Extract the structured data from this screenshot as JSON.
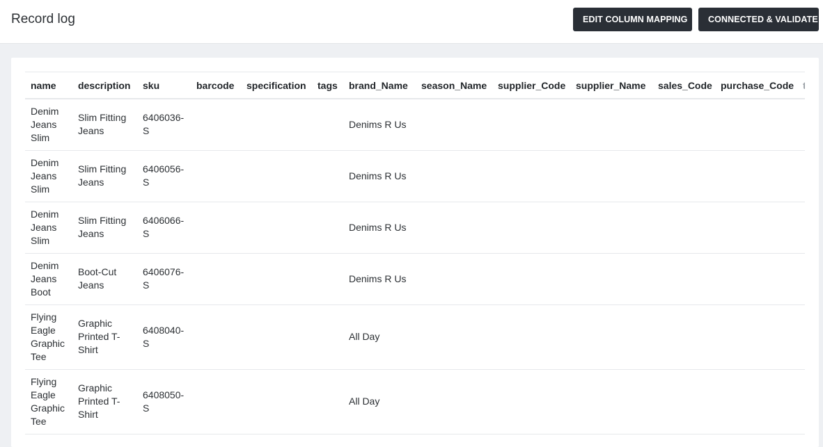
{
  "header": {
    "title": "Record log",
    "buttons": {
      "edit_mapping": "EDIT COLUMN MAPPING",
      "connect_validate": "CONNECTED & VALIDATE"
    }
  },
  "table": {
    "columns": [
      "name",
      "description",
      "sku",
      "barcode",
      "specification",
      "tags",
      "brand_Name",
      "season_Name",
      "supplier_Code",
      "supplier_Name",
      "sales_Code",
      "purchase_Code",
      "t"
    ],
    "rows": [
      {
        "name": "Denim Jeans Slim",
        "description": "Slim Fitting Jeans",
        "sku": "6406036-S",
        "brand_Name": "Denims R Us"
      },
      {
        "name": "Denim Jeans Slim",
        "description": "Slim Fitting Jeans",
        "sku": "6406056-S",
        "brand_Name": "Denims R Us"
      },
      {
        "name": "Denim Jeans Slim",
        "description": "Slim Fitting Jeans",
        "sku": "6406066-S",
        "brand_Name": "Denims R Us"
      },
      {
        "name": "Denim Jeans Boot",
        "description": "Boot-Cut Jeans",
        "sku": "6406076-S",
        "brand_Name": "Denims R Us"
      },
      {
        "name": "Flying Eagle Graphic Tee",
        "description": "Graphic Printed T-Shirt",
        "sku": "6408040-S",
        "brand_Name": "All Day"
      },
      {
        "name": "Flying Eagle Graphic Tee",
        "description": "Graphic Printed T-Shirt",
        "sku": "6408050-S",
        "brand_Name": "All Day"
      }
    ]
  }
}
